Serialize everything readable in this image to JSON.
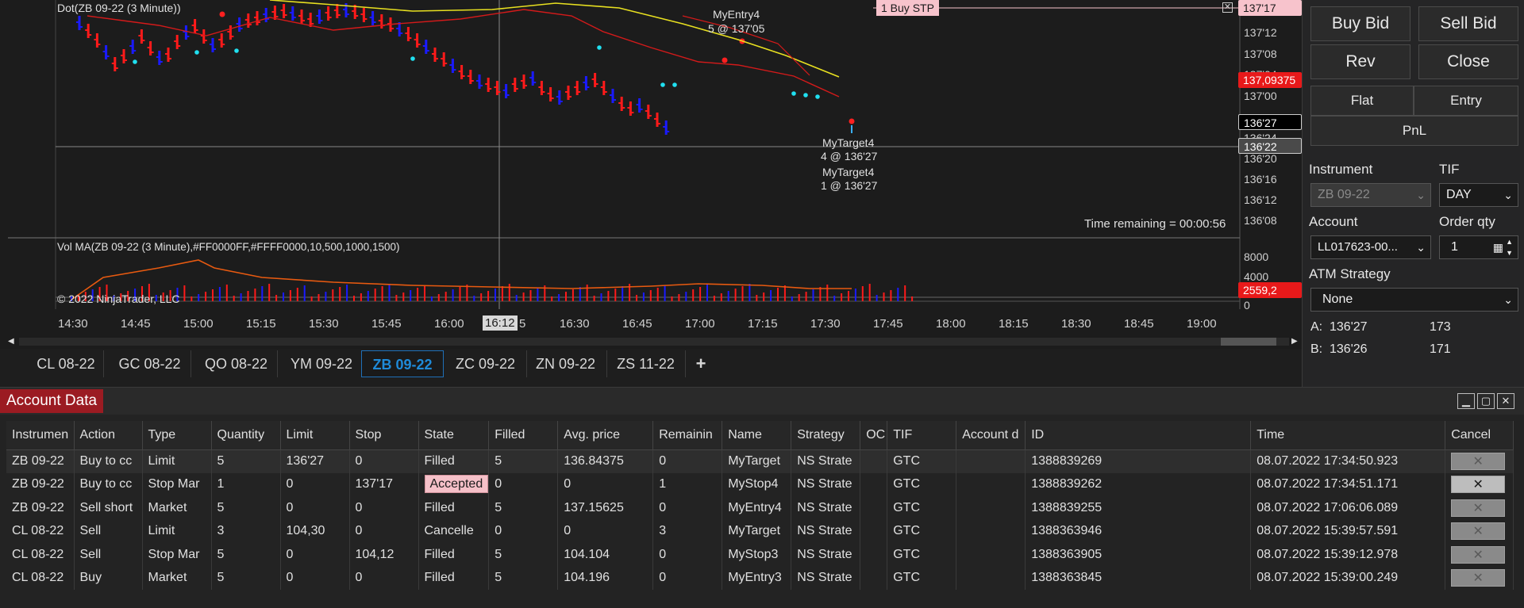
{
  "chart": {
    "indicator_label": "Dot(ZB 09-22 (3 Minute))",
    "vol_label": "Vol MA(ZB 09-22 (3 Minute),#FF0000FF,#FFFF0000,10,500,1000,1500)",
    "copyright": "© 2022 NinjaTrader, LLC",
    "time_remaining": "Time remaining = 00:00:56",
    "order_tag": "1 Buy STP",
    "annotations": {
      "entry_name": "MyEntry4",
      "entry_detail": "5 @ 137'05",
      "target_name_1": "MyTarget4",
      "target_detail_1": "4 @ 136'27",
      "target_name_2": "MyTarget4",
      "target_detail_2": "1 @ 136'27"
    },
    "price_axis": [
      "137'12",
      "137'08",
      "137'04",
      "137'00",
      "136'24",
      "136'20",
      "136'16",
      "136'12",
      "136'08"
    ],
    "vol_axis": [
      "8000",
      "4000",
      "0"
    ],
    "price_tags": {
      "top": "137'17",
      "last": "137,09375",
      "current": "136'27",
      "crosshair": "136'22",
      "volume": "2559,2"
    },
    "time_axis": [
      "14:30",
      "14:45",
      "15:00",
      "15:15",
      "15:30",
      "15:45",
      "16:00",
      "16:12",
      "16:30",
      "16:45",
      "17:00",
      "17:15",
      "17:30",
      "17:45",
      "18:00",
      "18:15",
      "18:30",
      "18:45",
      "19:00"
    ],
    "crosshair_time_suffix": "5"
  },
  "panel": {
    "buy_bid": "Buy Bid",
    "sell_bid": "Sell Bid",
    "rev": "Rev",
    "close": "Close",
    "flat": "Flat",
    "entry": "Entry",
    "pnl": "PnL",
    "instrument_label": "Instrument",
    "instrument_value": "ZB 09-22",
    "tif_label": "TIF",
    "tif_value": "DAY",
    "account_label": "Account",
    "account_value": "LL017623-00...",
    "qty_label": "Order qty",
    "qty_value": "1",
    "atm_label": "ATM Strategy",
    "atm_value": "None",
    "ask_label": "A:",
    "ask_price": "136'27",
    "ask_size": "173",
    "bid_label": "B:",
    "bid_price": "136'26",
    "bid_size": "171"
  },
  "tabs": [
    "CL 08-22",
    "GC 08-22",
    "QO 08-22",
    "YM 09-22",
    "ZB 09-22",
    "ZC 09-22",
    "ZN 09-22",
    "ZS 11-22",
    "+"
  ],
  "active_tab": "ZB 09-22",
  "account_data": {
    "title": "Account Data",
    "columns": [
      "Instrumen",
      "Action",
      "Type",
      "Quantity",
      "Limit",
      "Stop",
      "State",
      "Filled",
      "Avg. price",
      "Remainin",
      "Name",
      "Strategy",
      "OC",
      "TIF",
      "Account d",
      "ID",
      "Time",
      "Cancel"
    ],
    "rows": [
      [
        "ZB 09-22",
        "Buy to cc",
        "Limit",
        "5",
        "136'27",
        "0",
        "Filled",
        "5",
        "136.84375",
        "0",
        "MyTarget",
        "NS Strate",
        "",
        "GTC",
        "",
        "1388839269",
        "08.07.2022 17:34:50.923",
        "✕"
      ],
      [
        "ZB 09-22",
        "Buy to cc",
        "Stop Mar",
        "1",
        "0",
        "137'17",
        "Accepted",
        "0",
        "0",
        "1",
        "MyStop4",
        "NS Strate",
        "",
        "GTC",
        "",
        "1388839262",
        "08.07.2022 17:34:51.171",
        "✕"
      ],
      [
        "ZB 09-22",
        "Sell short",
        "Market",
        "5",
        "0",
        "0",
        "Filled",
        "5",
        "137.15625",
        "0",
        "MyEntry4",
        "NS Strate",
        "",
        "GTC",
        "",
        "1388839255",
        "08.07.2022 17:06:06.089",
        "✕"
      ],
      [
        "CL 08-22",
        "Sell",
        "Limit",
        "3",
        "104,30",
        "0",
        "Cancelle",
        "0",
        "0",
        "3",
        "MyTarget",
        "NS Strate",
        "",
        "GTC",
        "",
        "1388363946",
        "08.07.2022 15:39:57.591",
        "✕"
      ],
      [
        "CL 08-22",
        "Sell",
        "Stop Mar",
        "5",
        "0",
        "104,12",
        "Filled",
        "5",
        "104.104",
        "0",
        "MyStop3",
        "NS Strate",
        "",
        "GTC",
        "",
        "1388363905",
        "08.07.2022 15:39:12.978",
        "✕"
      ],
      [
        "CL 08-22",
        "Buy",
        "Market",
        "5",
        "0",
        "0",
        "Filled",
        "5",
        "104.196",
        "0",
        "MyEntry3",
        "NS Strate",
        "",
        "GTC",
        "",
        "1388363845",
        "08.07.2022 15:39:00.249",
        "✕"
      ]
    ]
  },
  "colors": {
    "up_bar": "#1a1aff",
    "down_bar": "#ff1a1a",
    "ma_yellow": "#e8e020",
    "ma_red": "#d41a1a",
    "vol_ma": "#e85a10",
    "account_title_bg": "#9b1b22",
    "active_tab": "#1f8ad8"
  }
}
